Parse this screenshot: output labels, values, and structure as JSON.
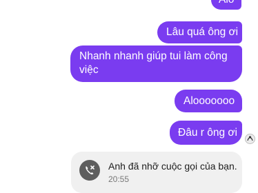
{
  "messages": [
    {
      "text": "Alo"
    },
    {
      "text": "Lâu quá ông ơi"
    },
    {
      "text": "Nhanh nhanh giúp tui làm công việc"
    },
    {
      "text": "Alooooooo"
    },
    {
      "text": "Đâu r ông ơi"
    }
  ],
  "missed_call": {
    "text": "Anh đã nhỡ cuộc gọi của bạn.",
    "time": "20:55",
    "icon": "missed-call-icon"
  },
  "colors": {
    "bubble": "#7a3cf0",
    "card": "#f0f0f0",
    "call_icon_bg": "#5e5e5e"
  }
}
